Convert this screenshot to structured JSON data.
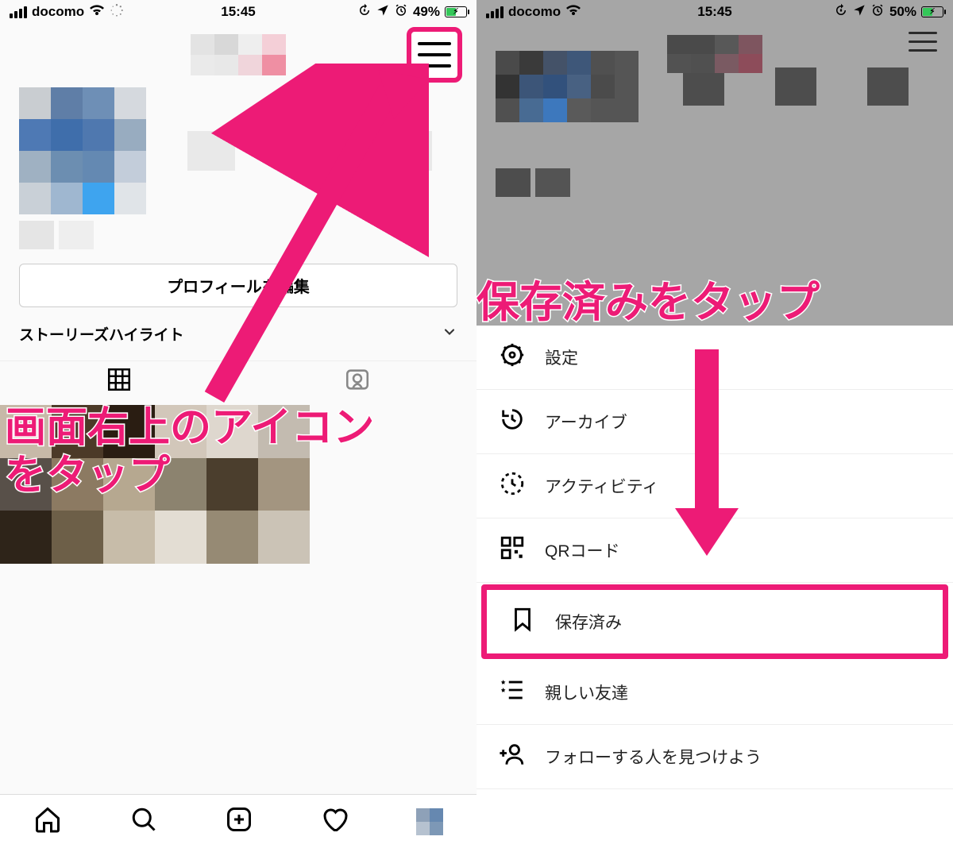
{
  "annotation": {
    "left_text_line1": "画面右上のアイコン",
    "left_text_line2": "をタップ",
    "right_text": "保存済みをタップ"
  },
  "statusbar_left": {
    "carrier": "docomo",
    "time": "15:45",
    "battery_pct": "49%"
  },
  "statusbar_right": {
    "carrier": "docomo",
    "time": "15:45",
    "battery_pct": "50%"
  },
  "profile": {
    "edit_button": "プロフィールを編集",
    "highlights_label": "ストーリーズハイライト"
  },
  "menu": {
    "items": [
      {
        "key": "settings",
        "label": "設定"
      },
      {
        "key": "archive",
        "label": "アーカイブ"
      },
      {
        "key": "activity",
        "label": "アクティビティ"
      },
      {
        "key": "qr",
        "label": "QRコード"
      },
      {
        "key": "saved",
        "label": "保存済み"
      },
      {
        "key": "close_friends",
        "label": "親しい友達"
      },
      {
        "key": "discover",
        "label": "フォローする人を見つけよう"
      }
    ]
  },
  "colors": {
    "accent": "#ed1b76"
  }
}
